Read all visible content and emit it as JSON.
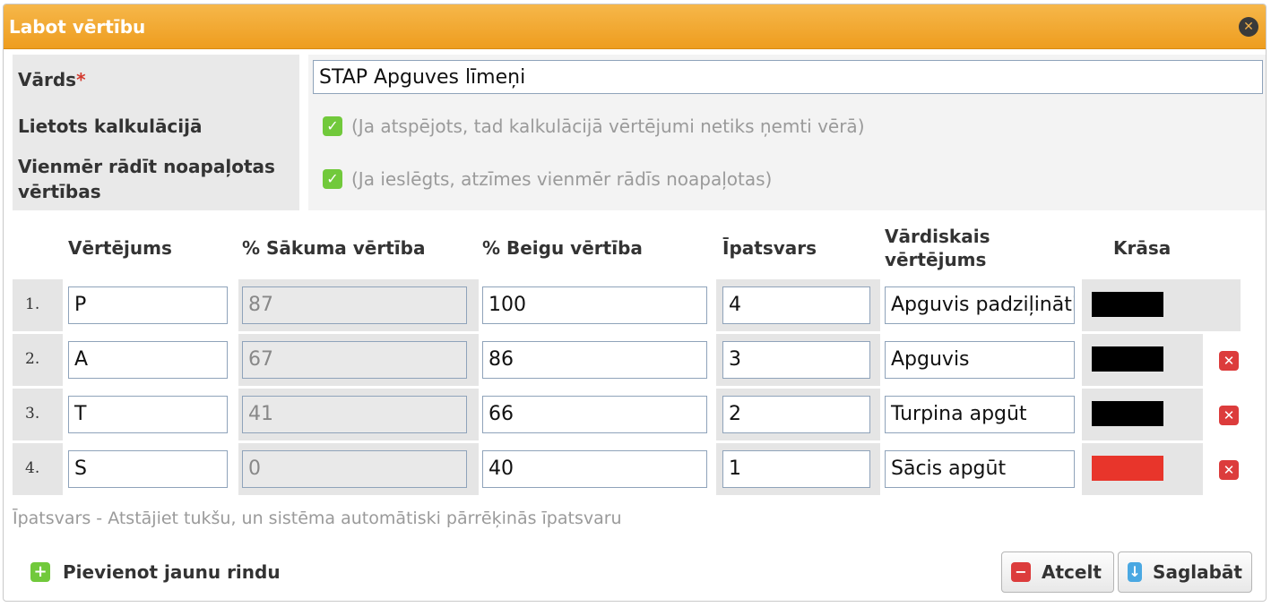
{
  "dialog": {
    "title": "Labot vērtību"
  },
  "form": {
    "name_label": "Vārds",
    "required_mark": "*",
    "name_value": "STAP Apguves līmeņi",
    "used_in_calc_label": "Lietots kalkulācijā",
    "used_in_calc_hint": "(Ja atspējots, tad kalkulācijā vērtējumi netiks ņemti vērā)",
    "used_in_calc_checked": true,
    "rounded_label": "Vienmēr rādīt noapaļotas vērtības",
    "rounded_hint": "(Ja ieslēgts, atzīmes vienmēr rādīs noapaļotas)",
    "rounded_checked": true
  },
  "table": {
    "headers": {
      "grade": "Vērtējums",
      "start": "% Sākuma vērtība",
      "end": "% Beigu vērtība",
      "weight": "Īpatsvars",
      "verbal": "Vārdiskais vērtējums",
      "color": "Krāsa"
    },
    "rows": [
      {
        "num": "1.",
        "grade": "P",
        "start": "87",
        "end": "100",
        "weight": "4",
        "verbal": "Apguvis padziļināti",
        "color": "#000000"
      },
      {
        "num": "2.",
        "grade": "A",
        "start": "67",
        "end": "86",
        "weight": "3",
        "verbal": "Apguvis",
        "color": "#000000"
      },
      {
        "num": "3.",
        "grade": "T",
        "start": "41",
        "end": "66",
        "weight": "2",
        "verbal": "Turpina apgūt",
        "color": "#000000"
      },
      {
        "num": "4.",
        "grade": "S",
        "start": "0",
        "end": "40",
        "weight": "1",
        "verbal": "Sācis apgūt",
        "color": "#e8352b"
      }
    ]
  },
  "footnote": "Īpatsvars - Atstājiet tukšu, un sistēma automātiski pārrēķinās īpatsvaru",
  "actions": {
    "add_row": "Pievienot jaunu rindu",
    "cancel": "Atcelt",
    "save": "Saglabāt"
  },
  "colors": {
    "accent": "#f0a52b",
    "check": "#71c93b",
    "danger": "#dc3c3c",
    "info": "#4aa8e2"
  }
}
